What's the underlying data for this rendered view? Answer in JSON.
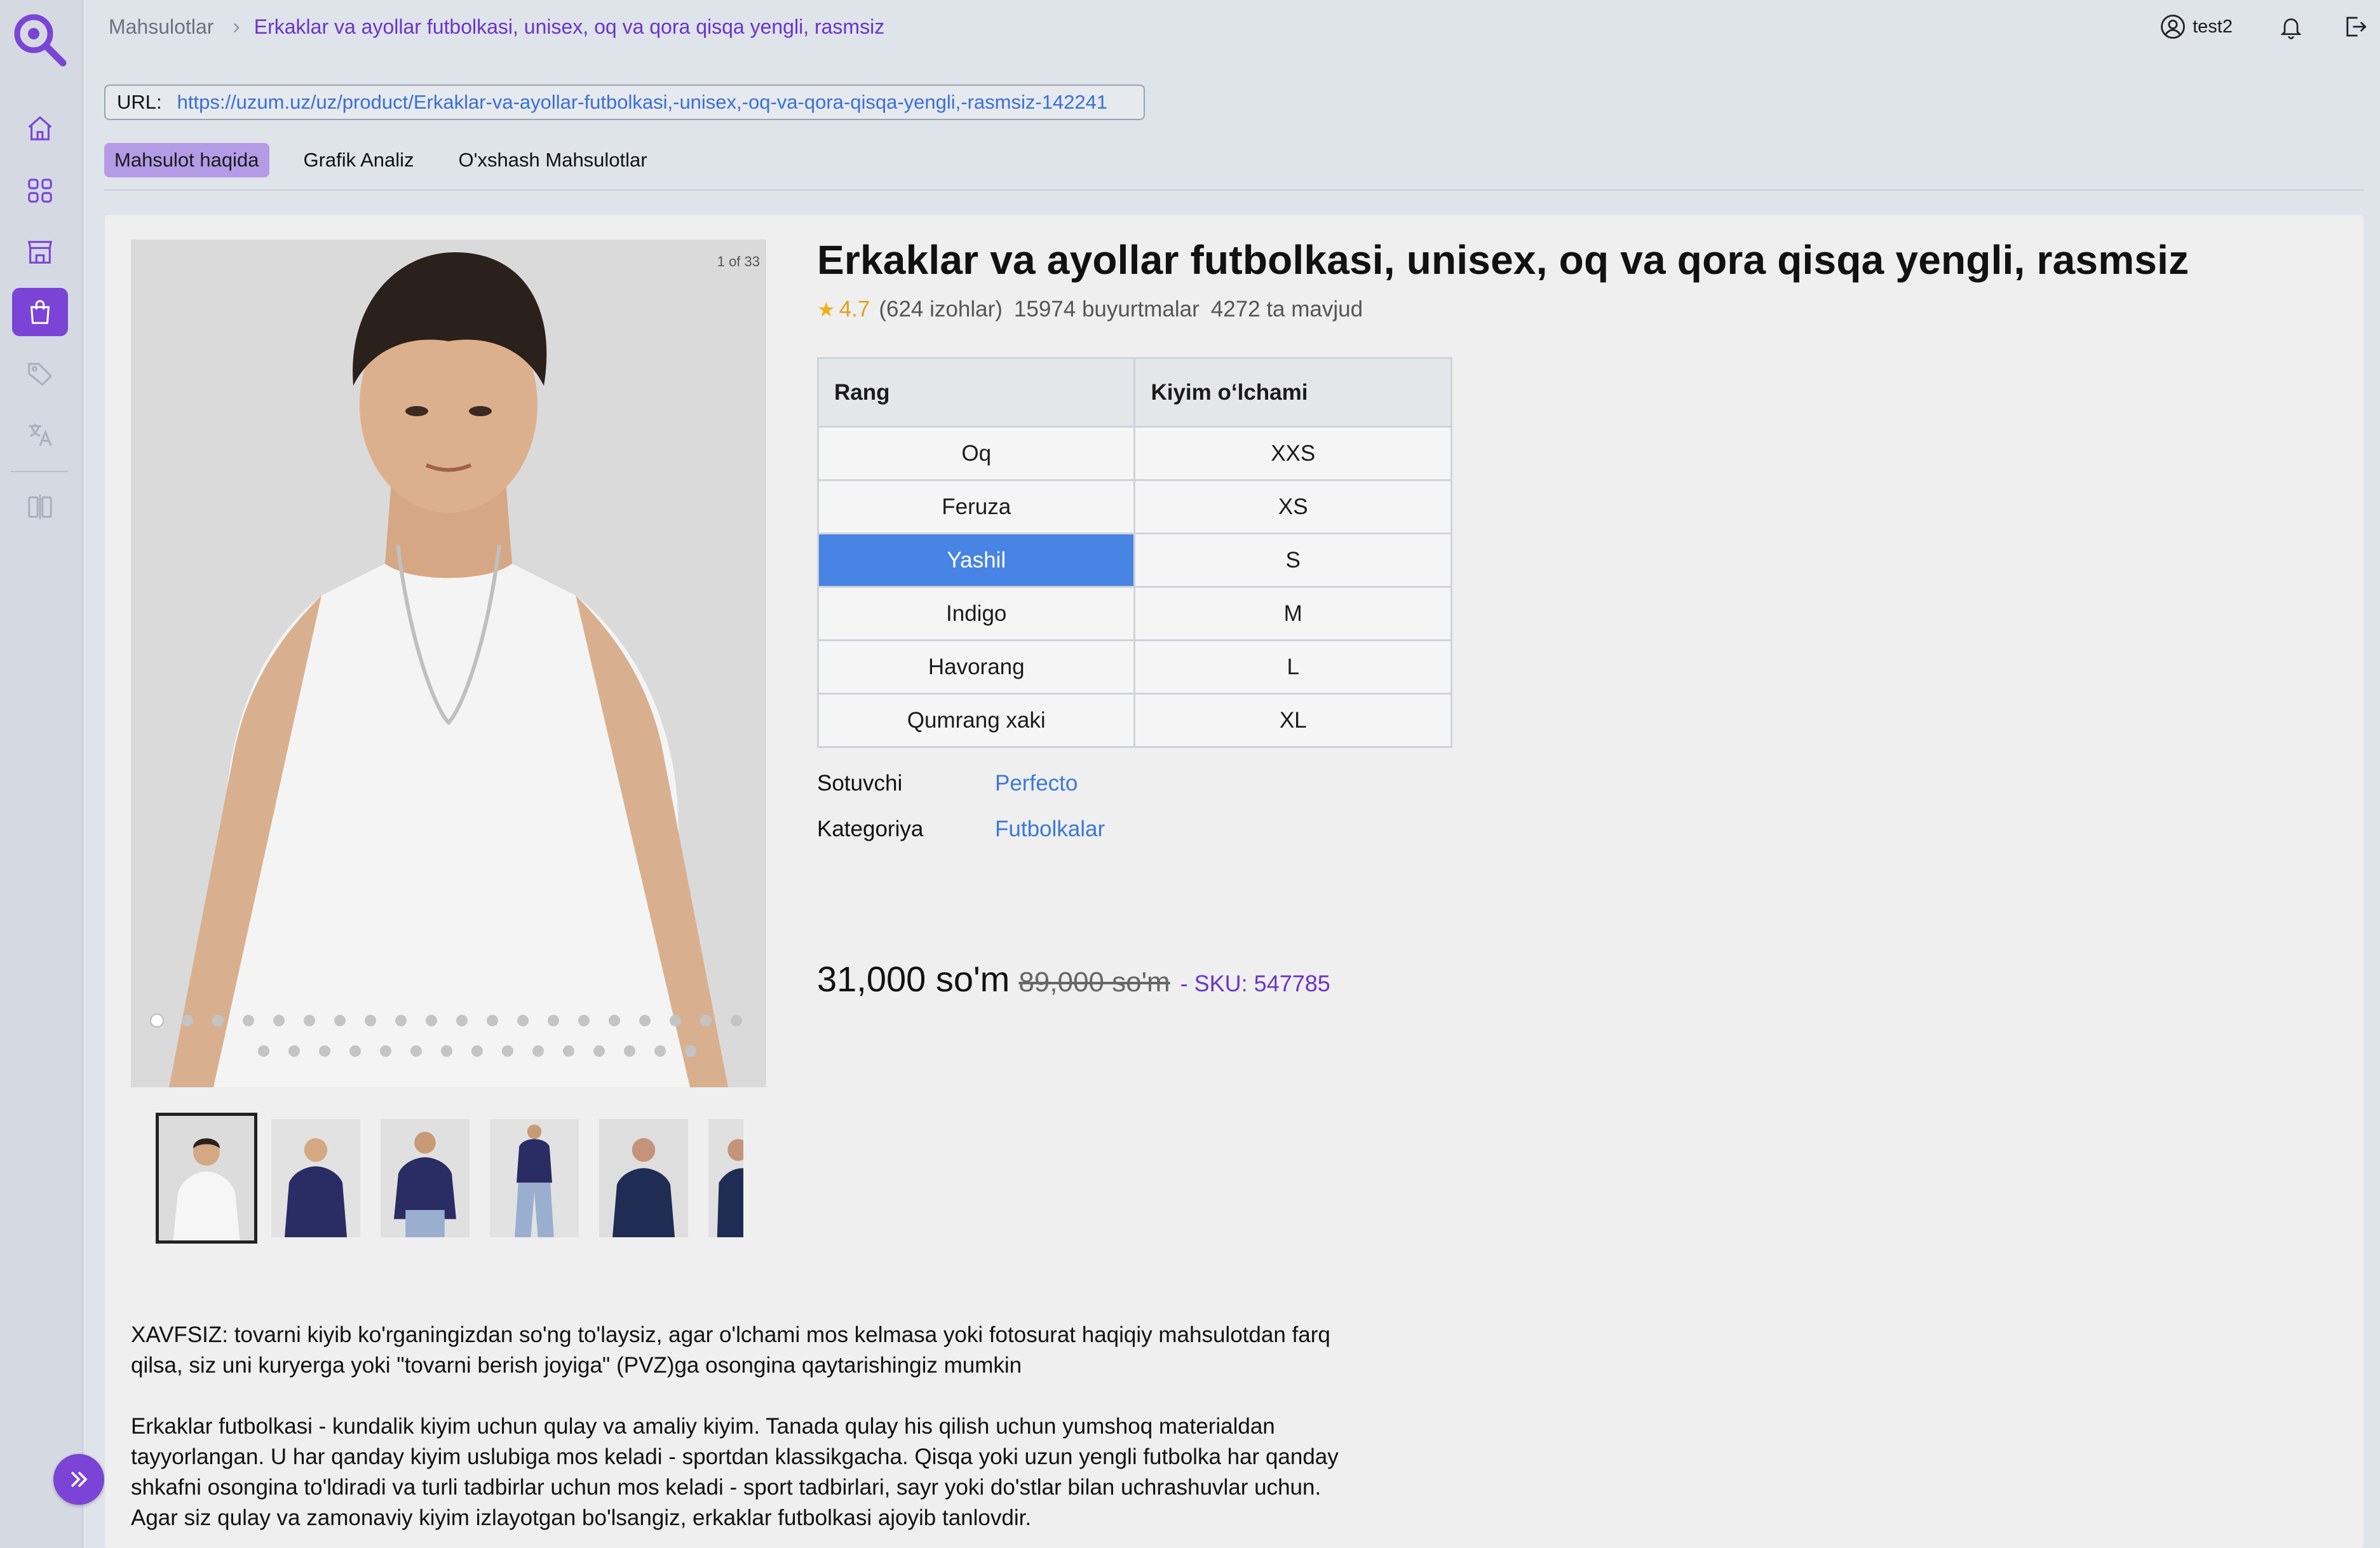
{
  "colors": {
    "accent": "#7b43d6",
    "link": "#3c78d8",
    "selected": "#4784e4",
    "rating": "#f2b01e"
  },
  "breadcrumb": {
    "root": "Mahsulotlar",
    "current": "Erkaklar va ayollar futbolkasi, unisex, oq va qora qisqa yengli, rasmsiz"
  },
  "header": {
    "username": "test2"
  },
  "url": {
    "label": "URL:",
    "value": "https://uzum.uz/uz/product/Erkaklar-va-ayollar-futbolkasi,-unisex,-oq-va-qora-qisqa-yengli,-rasmsiz-142241"
  },
  "tabs": [
    {
      "label": "Mahsulot haqida",
      "active": true
    },
    {
      "label": "Grafik Analiz",
      "active": false
    },
    {
      "label": "O'xshash Mahsulotlar",
      "active": false
    }
  ],
  "gallery": {
    "counter": "1 of 33",
    "thumbnail_count": 6
  },
  "product": {
    "title": "Erkaklar va ayollar futbolkasi, unisex, oq va qora qisqa yengli, rasmsiz",
    "rating": "4.7",
    "reviews": "(624 izohlar)",
    "orders": "15974 buyurtmalar",
    "stock": "4272 ta mavjud",
    "table": {
      "headers": [
        "Rang",
        "Kiyim oʻlchami"
      ],
      "rows": [
        [
          "Oq",
          "XXS"
        ],
        [
          "Feruza",
          "XS"
        ],
        [
          "Yashil",
          "S"
        ],
        [
          "Indigo",
          "M"
        ],
        [
          "Havorang",
          "L"
        ],
        [
          "Qumrang xaki",
          "XL"
        ]
      ],
      "selected_color": "Yashil"
    },
    "seller_label": "Sotuvchi",
    "seller": "Perfecto",
    "category_label": "Kategoriya",
    "category": "Futbolkalar",
    "price": "31,000 so'm",
    "old_price": "89,000 so'm",
    "sku": "- SKU: 547785"
  },
  "description": {
    "para1_line1": "XAVFSIZ: tovarni kiyib ko'rganingizdan so'ng to'laysiz, agar o'lchami mos kelmasa yoki fotosurat haqiqiy mahsulotdan farq",
    "para1_line2": "qilsa, siz uni kuryerga yoki \"tovarni berish joyiga\" (PVZ)ga osongina qaytarishingiz mumkin",
    "para2_line1": "Erkaklar futbolkasi - kundalik kiyim uchun qulay va amaliy kiyim. Tanada qulay his qilish uchun yumshoq materialdan",
    "para2_line2": "tayyorlangan. U har qanday kiyim uslubiga mos keladi - sportdan klassikgacha. Qisqa yoki uzun yengli futbolka har qanday",
    "para2_line3": "shkafni osongina to'ldiradi va turli tadbirlar uchun mos keladi - sport tadbirlari, sayr yoki do'stlar bilan uchrashuvlar uchun.",
    "para2_line4": "Agar siz qulay va zamonaviy kiyim izlayotgan bo'lsangiz, erkaklar futbolkasi ajoyib tanlovdir."
  }
}
